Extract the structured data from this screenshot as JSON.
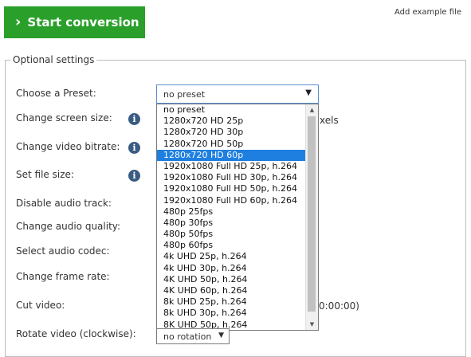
{
  "header": {
    "start_label": "Start conversion",
    "add_example": "Add example file"
  },
  "settings": {
    "legend": "Optional settings",
    "labels": {
      "preset": "Choose a Preset:",
      "screen_size": "Change screen size:",
      "video_bitrate": "Change video bitrate:",
      "file_size": "Set file size:",
      "disable_audio": "Disable audio track:",
      "audio_quality": "Change audio quality:",
      "audio_codec": "Select audio codec:",
      "frame_rate": "Change frame rate:",
      "cut_video": "Cut video:",
      "rotate": "Rotate video (clockwise):"
    },
    "info_glyph": "i",
    "peek": {
      "pixels_tail": "xels",
      "cut_time_tail": "0:00:00)"
    },
    "rotate_value": "no rotation"
  },
  "preset": {
    "selected_value": "no preset",
    "highlighted_index": 4,
    "options": [
      "no preset",
      "1280x720 HD 25p",
      "1280x720 HD 30p",
      "1280x720 HD 50p",
      "1280x720 HD 60p",
      "1920x1080 Full HD 25p, h.264",
      "1920x1080 Full HD 30p, h.264",
      "1920x1080 Full HD 50p, h.264",
      "1920x1080 Full HD 60p, h.264",
      "480p 25fps",
      "480p 30fps",
      "480p 50fps",
      "480p 60fps",
      "4k UHD 25p, h.264",
      "4k UHD 30p, h.264",
      "4K UHD 50p, h.264",
      "4K UHD 60p, h.264",
      "8k UHD 25p, h.264",
      "8k UHD 30p, h.264",
      "8K UHD 50p, h.264"
    ]
  },
  "icons": {
    "chevron": "›",
    "dropdown_arrow": "▼",
    "scroll_up": "▲",
    "scroll_down": "▼"
  },
  "colors": {
    "start_button": "#2aa02a",
    "highlight": "#1e7fe0",
    "info_icon": "#3a5c82"
  }
}
